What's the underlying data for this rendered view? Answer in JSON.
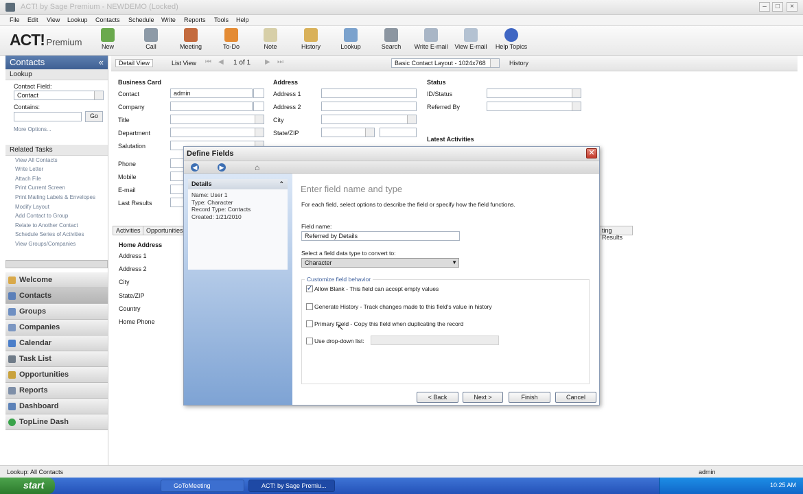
{
  "window": {
    "title": "ACT! by Sage Premium - NEWDEMO (Locked)"
  },
  "menu": [
    "File",
    "Edit",
    "View",
    "Lookup",
    "Contacts",
    "Schedule",
    "Write",
    "Reports",
    "Tools",
    "Help"
  ],
  "toolbar": {
    "logo_main": "ACT!",
    "logo_sub": "Premium",
    "buttons": [
      "New",
      "Call",
      "Meeting",
      "To-Do",
      "Note",
      "History",
      "Lookup",
      "Search",
      "Write E-mail",
      "View E-mail",
      "Help Topics"
    ]
  },
  "left": {
    "header": "Contacts",
    "lookup_title": "Lookup",
    "contact_field_label": "Contact Field:",
    "contact_field_value": "Contact",
    "contains_label": "Contains:",
    "go_label": "Go",
    "more_options": "More Options...",
    "related_title": "Related Tasks",
    "related": [
      "View All Contacts",
      "Write Letter",
      "Attach File",
      "Print Current Screen",
      "Print Mailing Labels & Envelopes",
      "Modify Layout",
      "Add Contact to Group",
      "Relate to Another Contact",
      "Schedule Series of Activities",
      "View Groups/Companies"
    ],
    "nav": [
      "Welcome",
      "Contacts",
      "Groups",
      "Companies",
      "Calendar",
      "Task List",
      "Opportunities",
      "Reports",
      "Dashboard",
      "TopLine Dash"
    ]
  },
  "viewbar": {
    "detail": "Detail View",
    "list": "List View",
    "record": "1 of 1",
    "layout": "Basic Contact Layout - 1024x768",
    "history": "History"
  },
  "form": {
    "business_card": "Business Card",
    "labels": [
      "Contact",
      "Company",
      "Title",
      "Department",
      "Salutation",
      "Phone",
      "Mobile",
      "E-mail",
      "Last Results"
    ],
    "contact_value": "admin",
    "address": "Address",
    "address_labels": [
      "Address 1",
      "Address 2",
      "City",
      "State/ZIP"
    ],
    "status": "Status",
    "status_labels": [
      "ID/Status",
      "Referred By"
    ],
    "latest": "Latest Activities",
    "tabs": [
      "Activities",
      "Opportunities"
    ],
    "tab_right": "ting Results",
    "home_address": "Home Address",
    "home_labels": [
      "Address 1",
      "Address 2",
      "City",
      "State/ZIP",
      "Country",
      "Home Phone"
    ]
  },
  "dialog": {
    "title": "Define Fields",
    "details_title": "Details",
    "details": [
      "Name: User 1",
      "Type: Character",
      "Record Type: Contacts",
      "Created: 1/21/2010"
    ],
    "heading": "Enter field name and type",
    "instructions": "For each field, select options to describe the field or specify how the field functions.",
    "field_name_label": "Field name:",
    "field_name_value": "Referred by Details",
    "type_label": "Select a field data type to convert to:",
    "type_value": "Character",
    "group_label": "Customize field behavior",
    "options": [
      {
        "label": "Allow Blank - This field can accept empty values",
        "checked": true
      },
      {
        "label": "Generate History - Track changes made to this field's value in history",
        "checked": false
      },
      {
        "label": "Primary Field - Copy this field when duplicating the record",
        "checked": false
      },
      {
        "label": "Use drop-down list:",
        "checked": false
      }
    ],
    "buttons": {
      "back": "< Back",
      "next": "Next >",
      "finish": "Finish",
      "cancel": "Cancel"
    }
  },
  "status": {
    "left": "Lookup: All Contacts",
    "user": "admin"
  },
  "taskbar": {
    "start": "start",
    "tasks": [
      "GoToMeeting",
      "ACT! by Sage Premiu..."
    ],
    "clock": "10:25 AM"
  }
}
